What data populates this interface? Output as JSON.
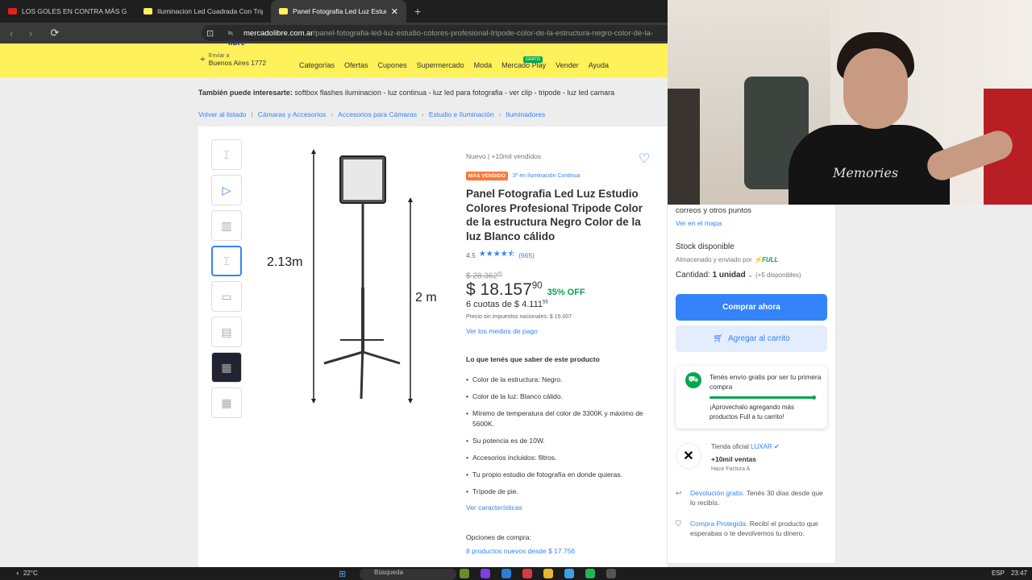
{
  "browser": {
    "tabs": [
      {
        "title": "LOS GOLES EN CONTRA MÁS GRACIOSOS",
        "favicon_color": "#e62117",
        "active": false
      },
      {
        "title": "Iluminacion Led Cuadrada Con Tripode",
        "favicon_color": "#fff159",
        "active": false
      },
      {
        "title": "Panel Fotografia Led Luz Estudio",
        "favicon_color": "#fff159",
        "active": true
      }
    ],
    "url_host": "mercadolibre.com.ar",
    "url_path": "/panel-fotografia-led-luz-estudio-colores-profesional-tripode-color-de-la-estructura-negro-color-de-la-"
  },
  "header": {
    "logo_fragment": "libre",
    "location_label": "Enviar a",
    "location_value": "Buenos Aires 1772",
    "nav": [
      "Categorías",
      "Ofertas",
      "Cupones",
      "Supermercado",
      "Moda",
      "Mercado Play",
      "Vender",
      "Ayuda"
    ],
    "mercado_play_badge": "GRATIS"
  },
  "also_interested": {
    "label": "También puede interesarte:",
    "items": "softbox flashes iluminacion - luz continua - luz led para fotografia - ver clip - tripode - luz led camara"
  },
  "breadcrumb": [
    "Volver al listado",
    "Cámaras y Accesorios",
    "Accesorios para Cámaras",
    "Estudio e Iluminación",
    "Iluminadores"
  ],
  "gallery": {
    "dim_left": "2.13m",
    "dim_right": "2 m",
    "selected_index": 3
  },
  "product": {
    "condition": "Nuevo  |  +10mil vendidos",
    "best_seller": "MÁS VENDIDO",
    "rank": "3º en Iluminación Continua",
    "title": "Panel Fotografia Led Luz Estudio Colores Profesional Tripode Color de la estructura Negro Color de la luz Blanco cálido",
    "rating": "4.5",
    "stars_value": 4.5,
    "reviews": "(665)",
    "old_price": "$ 28.362",
    "old_price_cents": "85",
    "price": "$ 18.157",
    "price_cents": "90",
    "discount": "35% OFF",
    "installments": "6 cuotas de $ 4.111",
    "installments_cents": "55",
    "national_tax": "Precio sin impuestos nacionales: $ 15.007",
    "payment_link": "Ver los medios de pago",
    "know_title": "Lo que tenés que saber de este producto",
    "bullets": [
      "Color de la estructura: Negro.",
      "Color de la luz: Blanco cálido.",
      "Mínimo de temperatura del color de 3300K y máximo de 5600K.",
      "Su potencia es de 10W.",
      "Accesorios incluidos: filtros.",
      "Tu propio estudio de fotografía en donde quieras.",
      "Trípode de pie."
    ],
    "features_link": "Ver características",
    "options_label": "Opciones de compra:",
    "options_link": "8 productos nuevos desde $ 17.756"
  },
  "buybox": {
    "shipping_partial": "correos y otros puntos",
    "map_link": "Ver en el mapa",
    "stock": "Stock disponible",
    "stored_by": "Almacenado y enviado por",
    "full": "FULL",
    "quantity_label": "Cantidad:",
    "quantity_value": "1 unidad",
    "available": "(+5 disponibles)",
    "buy_now": "Comprar ahora",
    "add_cart": "Agregar al carrito",
    "free_ship_text": "Tenés envío gratis por ser tu primera compra",
    "free_ship_hint": "¡Aprovechalo agregando más productos Full a tu carrito!",
    "store_label": "Tienda oficial",
    "store_name": "LUXAR",
    "store_sales": "+10mil ventas",
    "store_invoice": "Hace Factura A",
    "returns_link": "Devolución gratis.",
    "returns_text": "Tenés 30 días desde que lo recibís.",
    "protected_link": "Compra Protegida.",
    "protected_text": "Recibí el producto que esperabas o te devolvemos tu dinero."
  },
  "webcam": {
    "shirt_text": "Memories"
  },
  "taskbar": {
    "weather": "22°C",
    "search": "Búsqueda",
    "lang": "ESP",
    "time": "23:47"
  },
  "colors": {
    "ml_yellow": "#fff159",
    "ml_blue": "#3483fa",
    "green": "#00a650",
    "orange": "#ff7733"
  }
}
